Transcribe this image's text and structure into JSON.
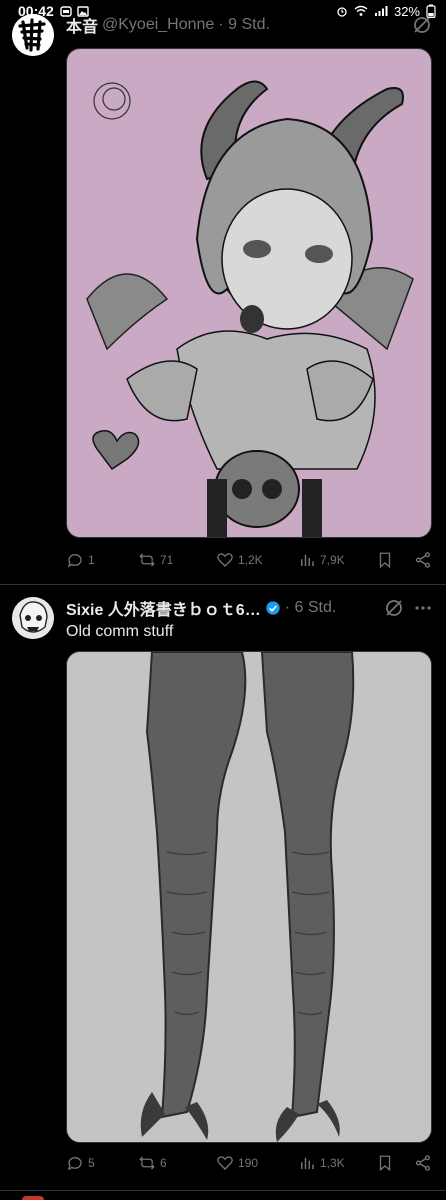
{
  "status_bar": {
    "time": "00:42",
    "battery": "32%"
  },
  "tweets": [
    {
      "author_name": "本音",
      "handle": "@Kyoei_Honne",
      "time": "· 9 Std.",
      "text": "",
      "media_background": "#c9a9c4",
      "actions": {
        "replies": "1",
        "reposts": "71",
        "likes": "1,2K",
        "views": "7,9K"
      }
    },
    {
      "author_name": "Sixie 人外落書きｂｏｔ6…",
      "handle": "",
      "time": "· 6 Std.",
      "text": "Old comm stuff",
      "media_background": "#c4c4c4",
      "actions": {
        "replies": "5",
        "reposts": "6",
        "likes": "190",
        "views": "1,3K"
      }
    }
  ],
  "colors": {
    "background": "#000000",
    "text": "#e7e9ea",
    "muted": "#71767b",
    "divider": "#2f3336",
    "verified": "#1d9bf0"
  }
}
